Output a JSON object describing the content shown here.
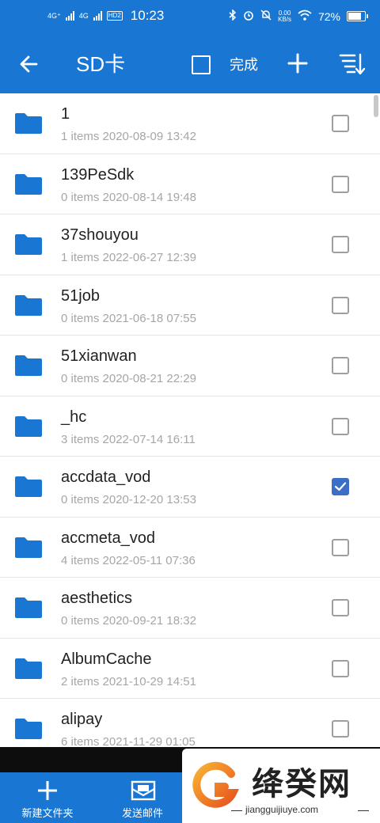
{
  "status_bar": {
    "net1": "4G⁺",
    "net2": "4G",
    "hd": "HD2",
    "time": "10:23",
    "speed_value": "0.00",
    "speed_unit": "KB/s",
    "battery": "72%"
  },
  "app_bar": {
    "title": "SD卡",
    "done_label": "完成"
  },
  "files": [
    {
      "name": "1",
      "meta": "1 items 2020-08-09 13:42",
      "checked": false
    },
    {
      "name": "139PeSdk",
      "meta": "0 items 2020-08-14 19:48",
      "checked": false
    },
    {
      "name": "37shouyou",
      "meta": "1 items 2022-06-27 12:39",
      "checked": false
    },
    {
      "name": "51job",
      "meta": "0 items 2021-06-18 07:55",
      "checked": false
    },
    {
      "name": "51xianwan",
      "meta": "0 items 2020-08-21 22:29",
      "checked": false
    },
    {
      "name": "_hc",
      "meta": "3 items 2022-07-14 16:11",
      "checked": false
    },
    {
      "name": "accdata_vod",
      "meta": "0 items 2020-12-20 13:53",
      "checked": true
    },
    {
      "name": "accmeta_vod",
      "meta": "4 items 2022-05-11 07:36",
      "checked": false
    },
    {
      "name": "aesthetics",
      "meta": "0 items 2020-09-21 18:32",
      "checked": false
    },
    {
      "name": "AlbumCache",
      "meta": "2 items 2021-10-29 14:51",
      "checked": false
    },
    {
      "name": "alipay",
      "meta": "6 items 2021-11-29 01:05",
      "checked": false
    }
  ],
  "bottom_bar": {
    "new_folder_label": "新建文件夹",
    "send_mail_label": "发送邮件"
  },
  "watermark": {
    "brand": "绛癸网",
    "url": "jiangguijiuye.com"
  },
  "colors": {
    "primary": "#1976d2",
    "checkbox_checked": "#3b6fc7",
    "folder": "#1976d2"
  }
}
